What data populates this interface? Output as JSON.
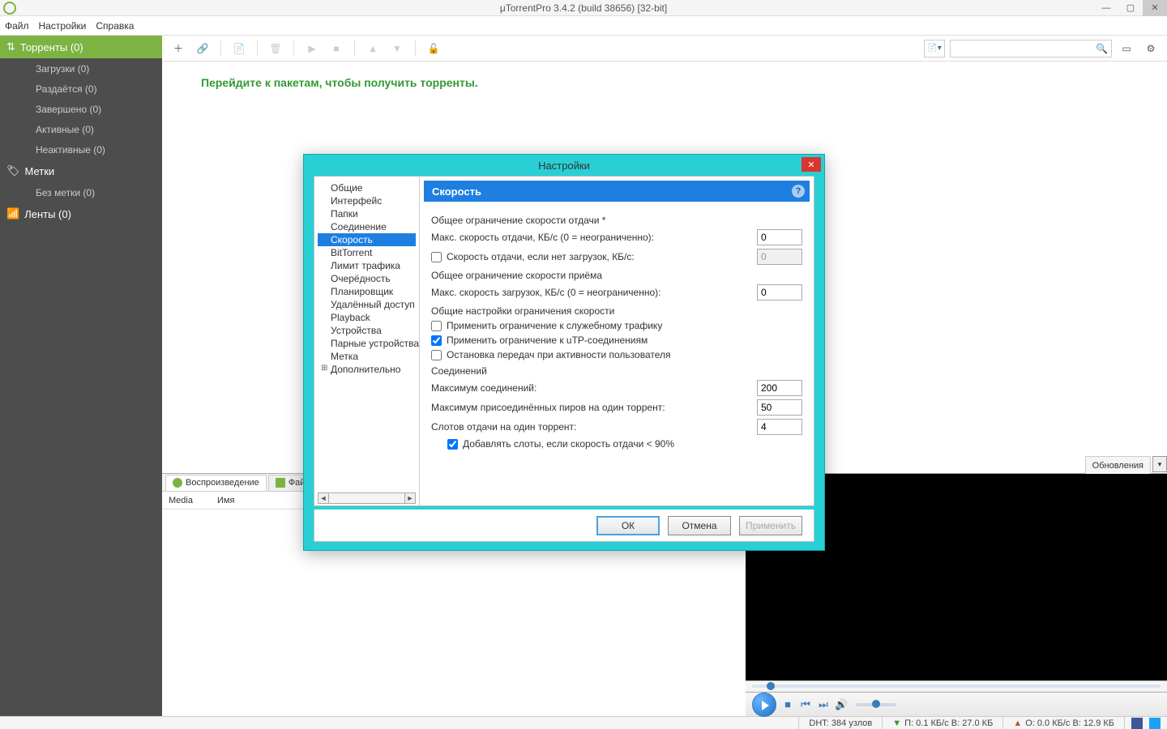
{
  "titlebar": {
    "title": "μTorrentPro 3.4.2  (build 38656) [32-bit]"
  },
  "menu": {
    "file": "Файл",
    "settings": "Настройки",
    "help": "Справка"
  },
  "sidebar": {
    "torrents_header": "Торренты (0)",
    "items": [
      "Загрузки (0)",
      "Раздаётся (0)",
      "Завершено (0)",
      "Активные (0)",
      "Неактивные (0)"
    ],
    "labels_header": "Метки",
    "no_label": "Без метки (0)",
    "feeds_header": "Ленты (0)"
  },
  "promo": "Перейдите к пакетам, чтобы получить торренты.",
  "tabs": {
    "play": "Воспроизведение",
    "files": "Файлы",
    "updates": "Обновления",
    "col_media": "Media",
    "col_name": "Имя"
  },
  "status": {
    "dht": "DHT: 384 узлов",
    "down": "П: 0.1 КБ/с В: 27.0 КБ",
    "up": "О: 0.0 КБ/с В: 12.9 КБ"
  },
  "dialog": {
    "title": "Настройки",
    "tree": [
      "Общие",
      "Интерфейс",
      "Папки",
      "Соединение",
      "Скорость",
      "BitTorrent",
      "Лимит трафика",
      "Очерёдность",
      "Планировщик",
      "Удалённый доступ",
      "Playback",
      "Устройства",
      "Парные устройства",
      "Метка",
      "Дополнительно"
    ],
    "selected": "Скорость",
    "section": "Скорость",
    "g1_label": "Общее ограничение скорости отдачи *",
    "g1_row1": "Макс. скорость отдачи, КБ/с (0 = неограниченно):",
    "g1_row1_val": "0",
    "g1_row2": "Скорость отдачи, если нет загрузок, КБ/с:",
    "g1_row2_val": "0",
    "g2_label": "Общее ограничение скорости приёма",
    "g2_row1": "Макс. скорость загрузок, КБ/с (0 = неограниченно):",
    "g2_row1_val": "0",
    "g3_label": "Общие настройки ограничения скорости",
    "g3_cb1": "Применить ограничение к служебному трафику",
    "g3_cb2": "Применить ограничение к uTP-соединениям",
    "g3_cb3": "Остановка передач при активности пользователя",
    "g4_label": "Соединений",
    "g4_row1": "Максимум соединений:",
    "g4_row1_val": "200",
    "g4_row2": "Максимум присоединённых пиров на один торрент:",
    "g4_row2_val": "50",
    "g4_row3": "Слотов отдачи на один торрент:",
    "g4_row3_val": "4",
    "g4_cb": "Добавлять слоты, если скорость отдачи < 90%",
    "ok": "ОК",
    "cancel": "Отмена",
    "apply": "Применить"
  }
}
